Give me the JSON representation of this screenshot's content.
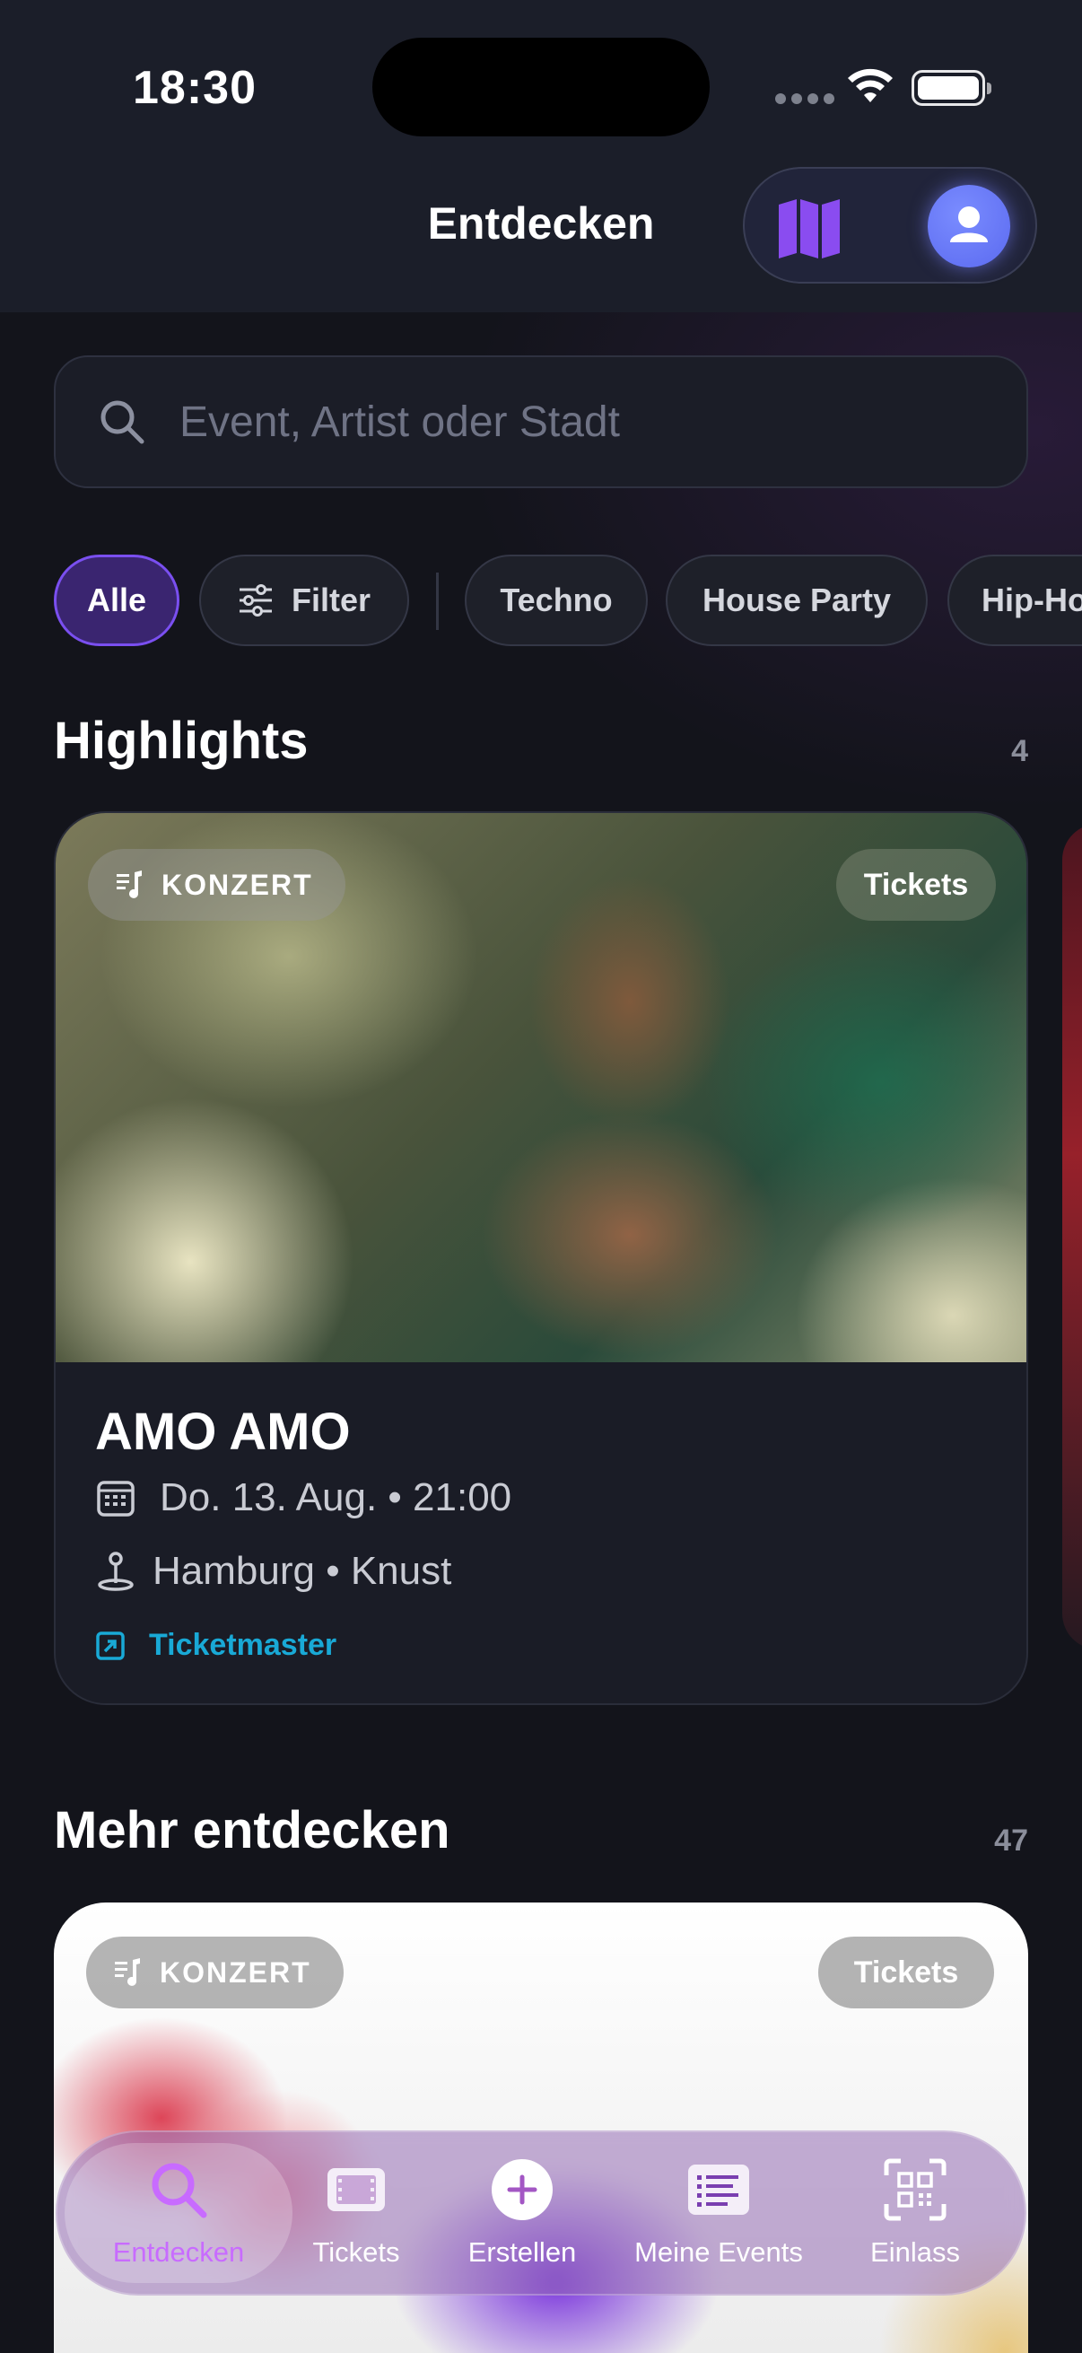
{
  "status_bar": {
    "time": "18:30"
  },
  "header": {
    "title": "Entdecken"
  },
  "search": {
    "placeholder": "Event, Artist oder Stadt",
    "value": ""
  },
  "chips": [
    {
      "label": "Alle",
      "active": true
    },
    {
      "label": "Filter",
      "icon": "sliders-icon"
    },
    {
      "label": "Techno"
    },
    {
      "label": "House Party"
    },
    {
      "label": "Hip-Hop"
    }
  ],
  "highlights": {
    "title": "Highlights",
    "count": "4",
    "card": {
      "category": "KONZERT",
      "tickets_label": "Tickets",
      "name": "AMO AMO",
      "datetime": "Do. 13. Aug. • 21:00",
      "location": "Hamburg • Knust",
      "provider": "Ticketmaster"
    }
  },
  "more": {
    "title": "Mehr entdecken",
    "count": "47",
    "card": {
      "category": "KONZERT",
      "tickets_label": "Tickets"
    }
  },
  "tabbar": {
    "items": [
      {
        "label": "Entdecken",
        "icon": "search-icon",
        "active": true
      },
      {
        "label": "Tickets",
        "icon": "ticket-icon"
      },
      {
        "label": "Erstellen",
        "icon": "plus-circle-icon"
      },
      {
        "label": "Meine Events",
        "icon": "list-icon"
      },
      {
        "label": "Einlass",
        "icon": "qr-scan-icon"
      }
    ]
  },
  "colors": {
    "accent": "#7a4ff0",
    "active_tab": "#c86bff",
    "link": "#19a9d6",
    "map_icon": "#8a4cf0"
  }
}
